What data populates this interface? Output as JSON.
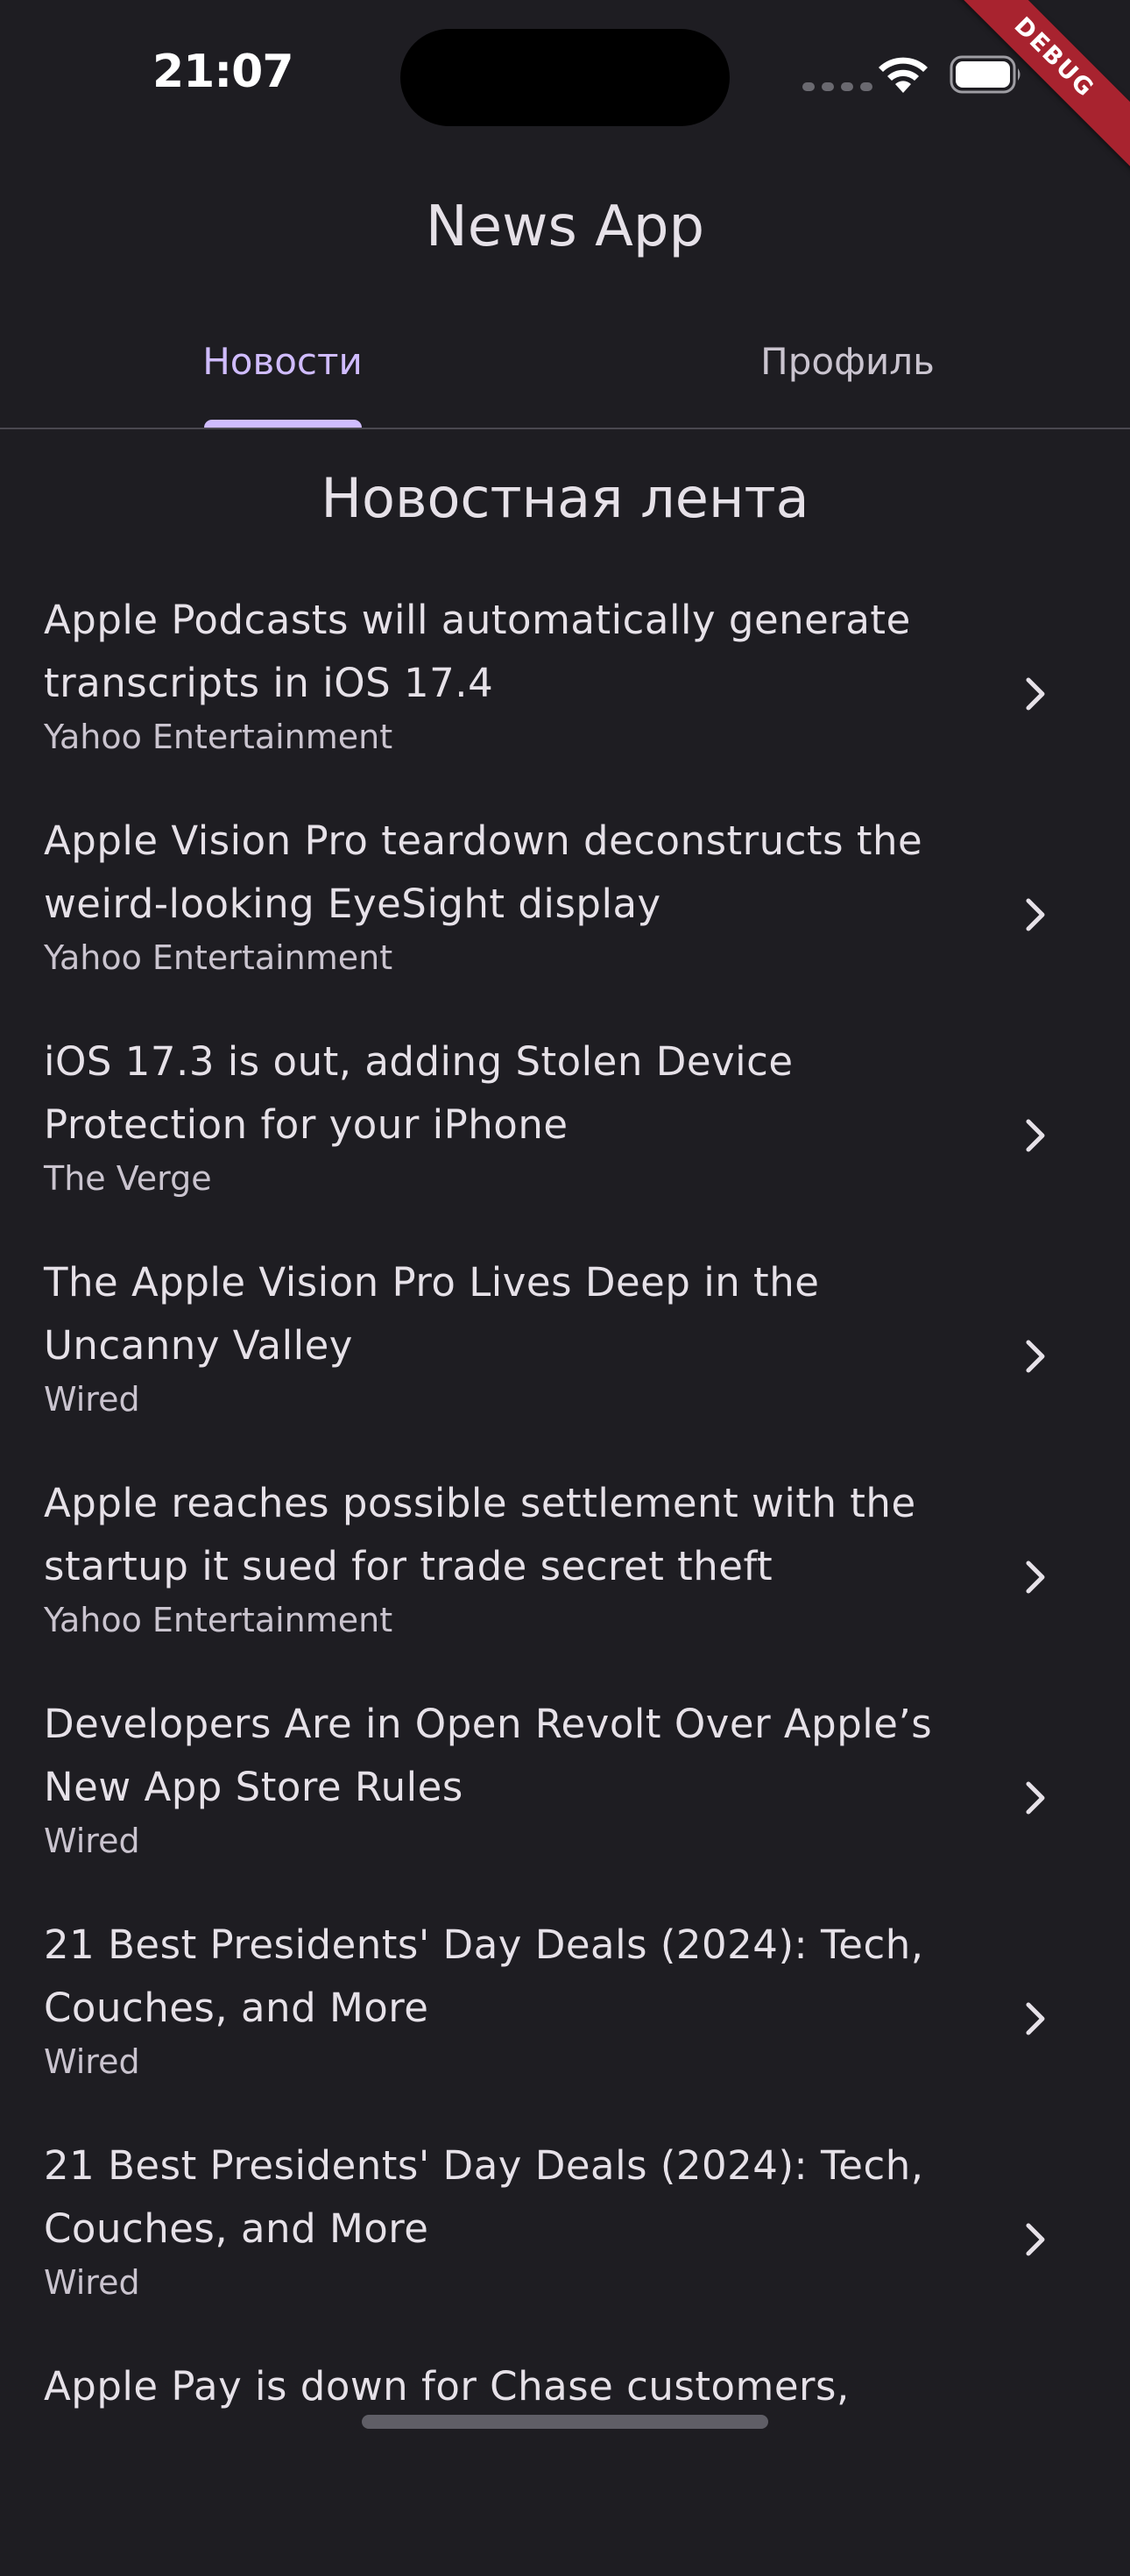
{
  "status_bar": {
    "time": "21:07"
  },
  "debug_banner": "DEBUG",
  "app_bar": {
    "title": "News App"
  },
  "tabs": [
    {
      "label": "Новости",
      "active": true
    },
    {
      "label": "Профиль",
      "active": false
    }
  ],
  "feed": {
    "title": "Новостная лента",
    "items": [
      {
        "title": "Apple Podcasts will automatically generate transcripts in iOS 17.4",
        "source": "Yahoo Entertainment"
      },
      {
        "title": "Apple Vision Pro teardown deconstructs the weird-looking EyeSight display",
        "source": "Yahoo Entertainment"
      },
      {
        "title": "iOS 17.3 is out, adding Stolen Device Protection for your iPhone",
        "source": "The Verge"
      },
      {
        "title": "The Apple Vision Pro Lives Deep in the Uncanny Valley",
        "source": "Wired"
      },
      {
        "title": "Apple reaches possible settlement with the startup it sued for trade secret theft",
        "source": "Yahoo Entertainment"
      },
      {
        "title": "Developers Are in Open Revolt Over Apple’s New App Store Rules",
        "source": "Wired"
      },
      {
        "title": "21 Best Presidents' Day Deals (2024): Tech, Couches, and More",
        "source": "Wired"
      },
      {
        "title": "21 Best Presidents' Day Deals (2024): Tech, Couches, and More",
        "source": "Wired"
      },
      {
        "title": "Apple Pay is down for Chase customers,",
        "source": ""
      }
    ]
  },
  "icons": {
    "chevron": "chevron-right-icon",
    "wifi": "wifi-icon",
    "battery": "battery-icon"
  },
  "colors": {
    "background": "#1e1d22",
    "accent": "#d0bcff",
    "debug_banner": "#a8232f"
  }
}
